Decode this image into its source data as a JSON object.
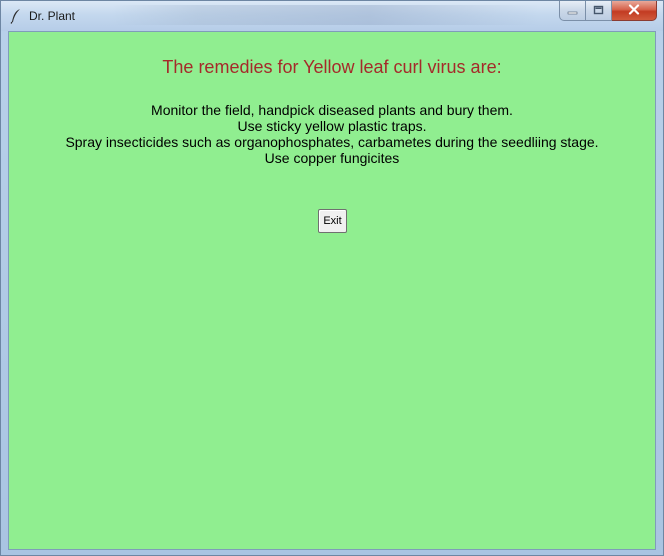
{
  "window": {
    "title": "Dr. Plant",
    "icons": {
      "app": "feather-icon",
      "minimize": "minimize-icon",
      "maximize": "maximize-icon",
      "close": "close-icon"
    }
  },
  "content": {
    "heading": "The remedies for Yellow leaf curl virus are:",
    "remedies": [
      "Monitor the field, handpick diseased plants and bury them.",
      "Use sticky yellow plastic traps.",
      "Spray insecticides such as organophosphates, carbametes during the seedliing stage.",
      "Use copper fungicites"
    ],
    "exit_label": "Exit"
  },
  "colors": {
    "background": "#90ee90",
    "heading": "#a52a2a",
    "text": "#000000"
  }
}
